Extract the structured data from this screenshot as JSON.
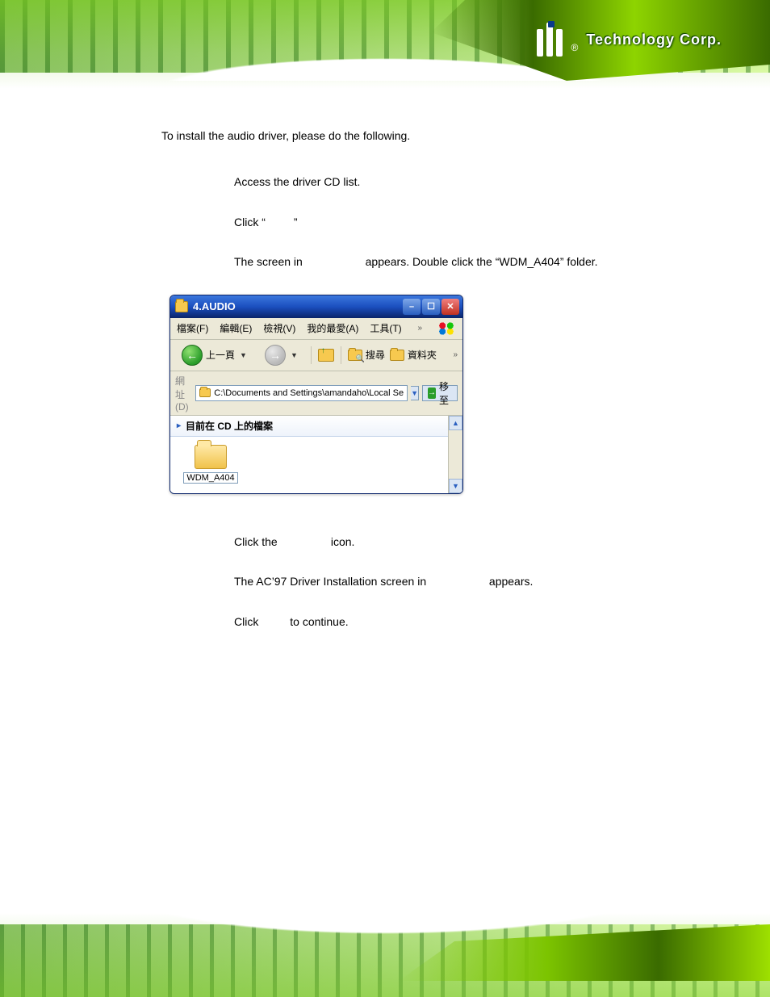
{
  "header": {
    "logo_text": "Technology Corp.",
    "logo_alt": "iEi"
  },
  "content": {
    "intro": "To install the audio driver, please do the following.",
    "step1": "Access the driver CD list.",
    "step2_prefix": "Click “",
    "step2_suffix": "”",
    "step3_prefix": "The screen in ",
    "step3_suffix": " appears. Double click the “WDM_A404” folder.",
    "step4_prefix": "Click the ",
    "step4_suffix": " icon.",
    "step5_prefix": "The AC’97 Driver Installation screen in ",
    "step5_suffix": " appears.",
    "step6_prefix": "Click ",
    "step6_suffix": " to continue."
  },
  "explorer": {
    "title": "4.AUDIO",
    "menu": {
      "file": "檔案(F)",
      "edit": "編輯(E)",
      "view": "檢視(V)",
      "favorites": "我的最愛(A)",
      "tools": "工具(T)",
      "chevron": "»"
    },
    "toolbar": {
      "back": "上一頁",
      "search": "搜尋",
      "folders": "資料夾",
      "chevron": "»"
    },
    "address": {
      "label": "網址(D)",
      "path": "C:\\Documents and Settings\\amandaho\\Local Se",
      "go": "移至"
    },
    "pane_header": "目前在 CD 上的檔案",
    "folder_name": "WDM_A404"
  }
}
